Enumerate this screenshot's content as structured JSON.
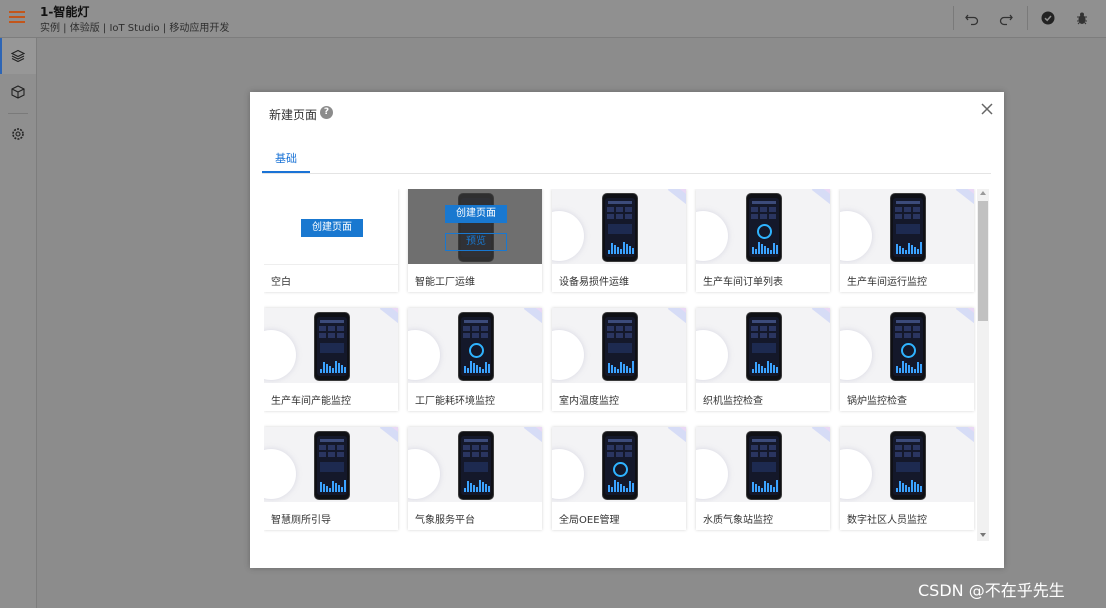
{
  "app": {
    "title": "1-智能灯",
    "subtitle": "实例 | 体验版 | IoT Studio | 移动应用开发"
  },
  "toolbar": {
    "icons": [
      "undo-icon",
      "redo-icon",
      "check-circle-icon",
      "bug-icon"
    ]
  },
  "sidebar": {
    "items": [
      {
        "icon": "layers-icon",
        "active": true
      },
      {
        "icon": "cube-icon",
        "active": false
      },
      {
        "icon": "settings-icon",
        "active": false
      }
    ]
  },
  "modal": {
    "title": "新建页面",
    "help": "?",
    "tab": "基础",
    "create_label": "创建页面",
    "preview_label": "预览"
  },
  "templates": [
    {
      "label": "空白"
    },
    {
      "label": "智能工厂运维"
    },
    {
      "label": "设备易损件运维"
    },
    {
      "label": "生产车间订单列表"
    },
    {
      "label": "生产车间运行监控"
    },
    {
      "label": "生产车间产能监控"
    },
    {
      "label": "工厂能耗环境监控"
    },
    {
      "label": "室内温度监控"
    },
    {
      "label": "织机监控检查"
    },
    {
      "label": "锅炉监控检查"
    },
    {
      "label": "智慧厕所引导"
    },
    {
      "label": "气象服务平台"
    },
    {
      "label": "全局OEE管理"
    },
    {
      "label": "水质气象站监控"
    },
    {
      "label": "数字社区人员监控"
    }
  ],
  "colors": {
    "accent": "#1a73d6",
    "menu": "#c3561b"
  },
  "watermark": "CSDN @不在乎先生"
}
